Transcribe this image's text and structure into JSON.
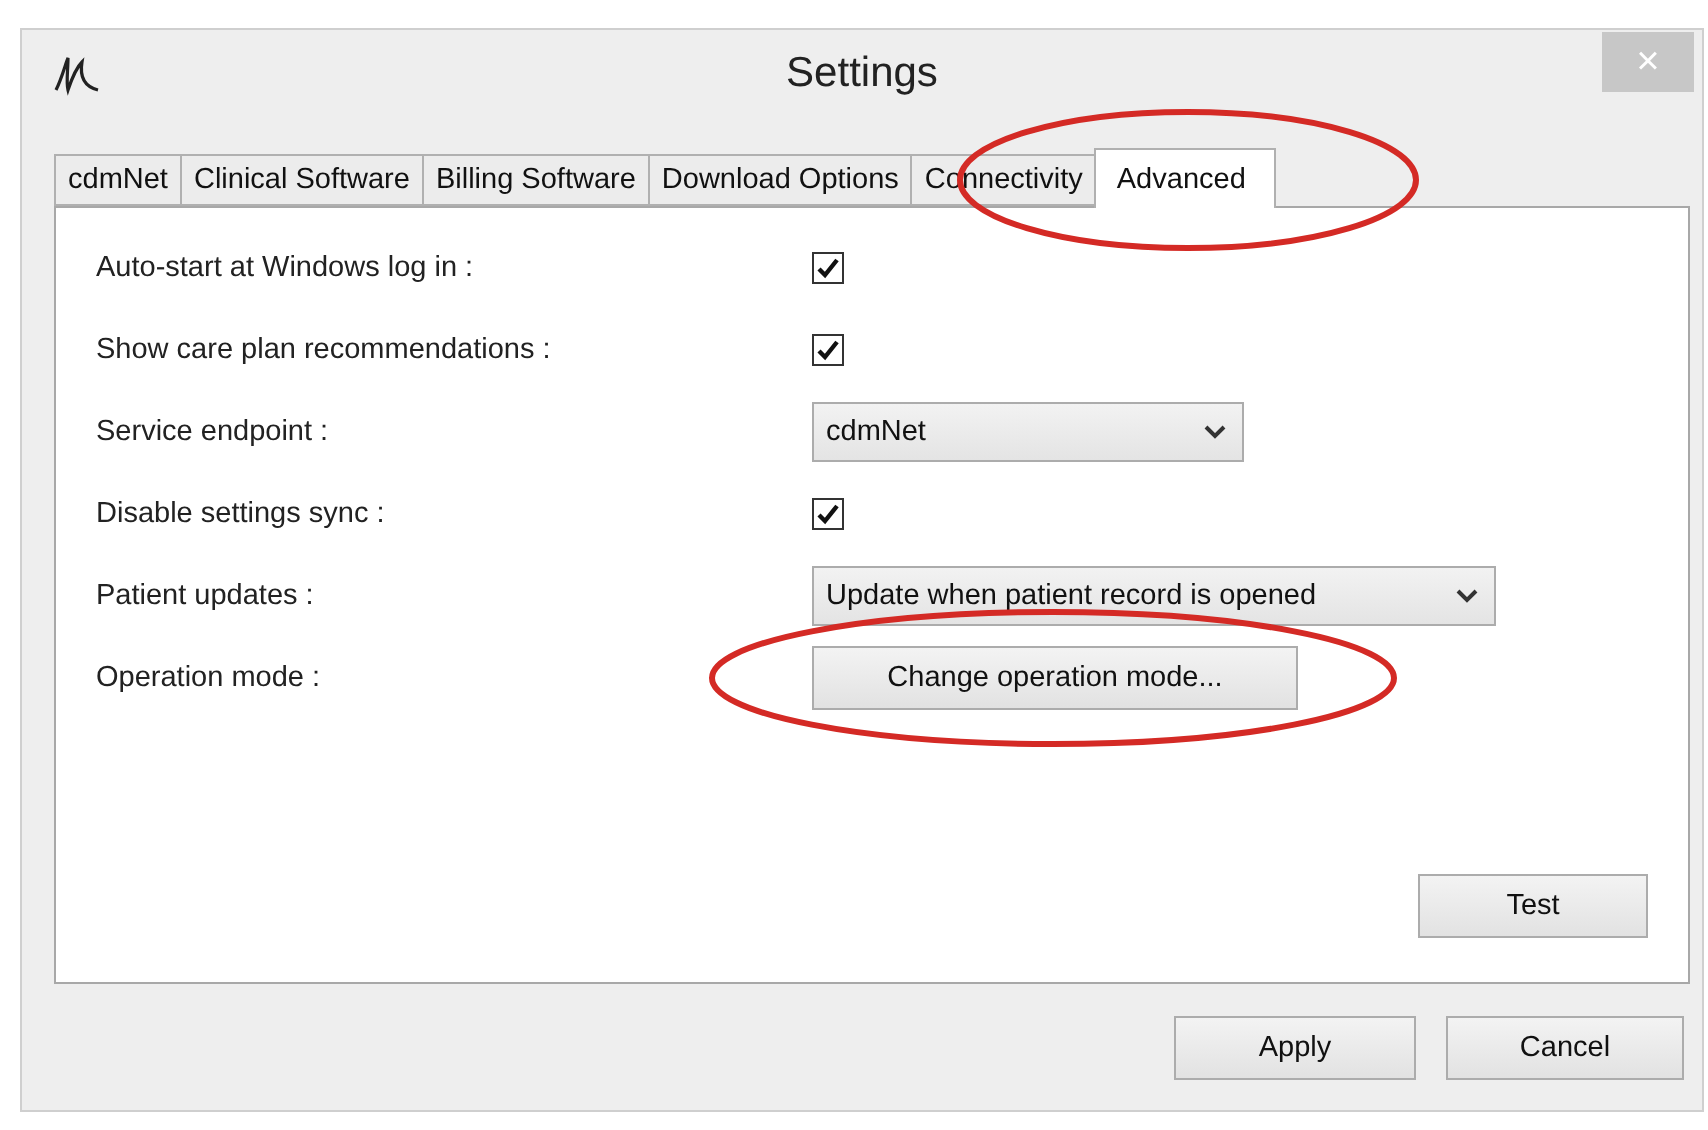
{
  "window": {
    "title": "Settings",
    "close": "×"
  },
  "tabs": [
    {
      "label": "cdmNet",
      "selected": false,
      "circled": false
    },
    {
      "label": "Clinical Software",
      "selected": false,
      "circled": false
    },
    {
      "label": "Billing Software",
      "selected": false,
      "circled": false
    },
    {
      "label": "Download Options",
      "selected": false,
      "circled": false
    },
    {
      "label": "Connectivity",
      "selected": false,
      "circled": false
    },
    {
      "label": "Advanced",
      "selected": true,
      "circled": true
    }
  ],
  "settings": [
    {
      "kind": "checkbox",
      "label": "Auto-start at Windows log in :",
      "checked": true
    },
    {
      "kind": "checkbox",
      "label": "Show care plan recommendations :",
      "checked": true
    },
    {
      "kind": "dropdown",
      "label": "Service endpoint :",
      "value": "cdmNet",
      "wide": false
    },
    {
      "kind": "checkbox",
      "label": "Disable settings sync :",
      "checked": true
    },
    {
      "kind": "dropdown",
      "label": "Patient updates :",
      "value": "Update when patient record is opened",
      "wide": true
    },
    {
      "kind": "button",
      "label": "Operation mode :",
      "button": "Change operation mode...",
      "circled": true
    }
  ],
  "test_button": "Test",
  "buttons": [
    "Apply",
    "Cancel"
  ]
}
